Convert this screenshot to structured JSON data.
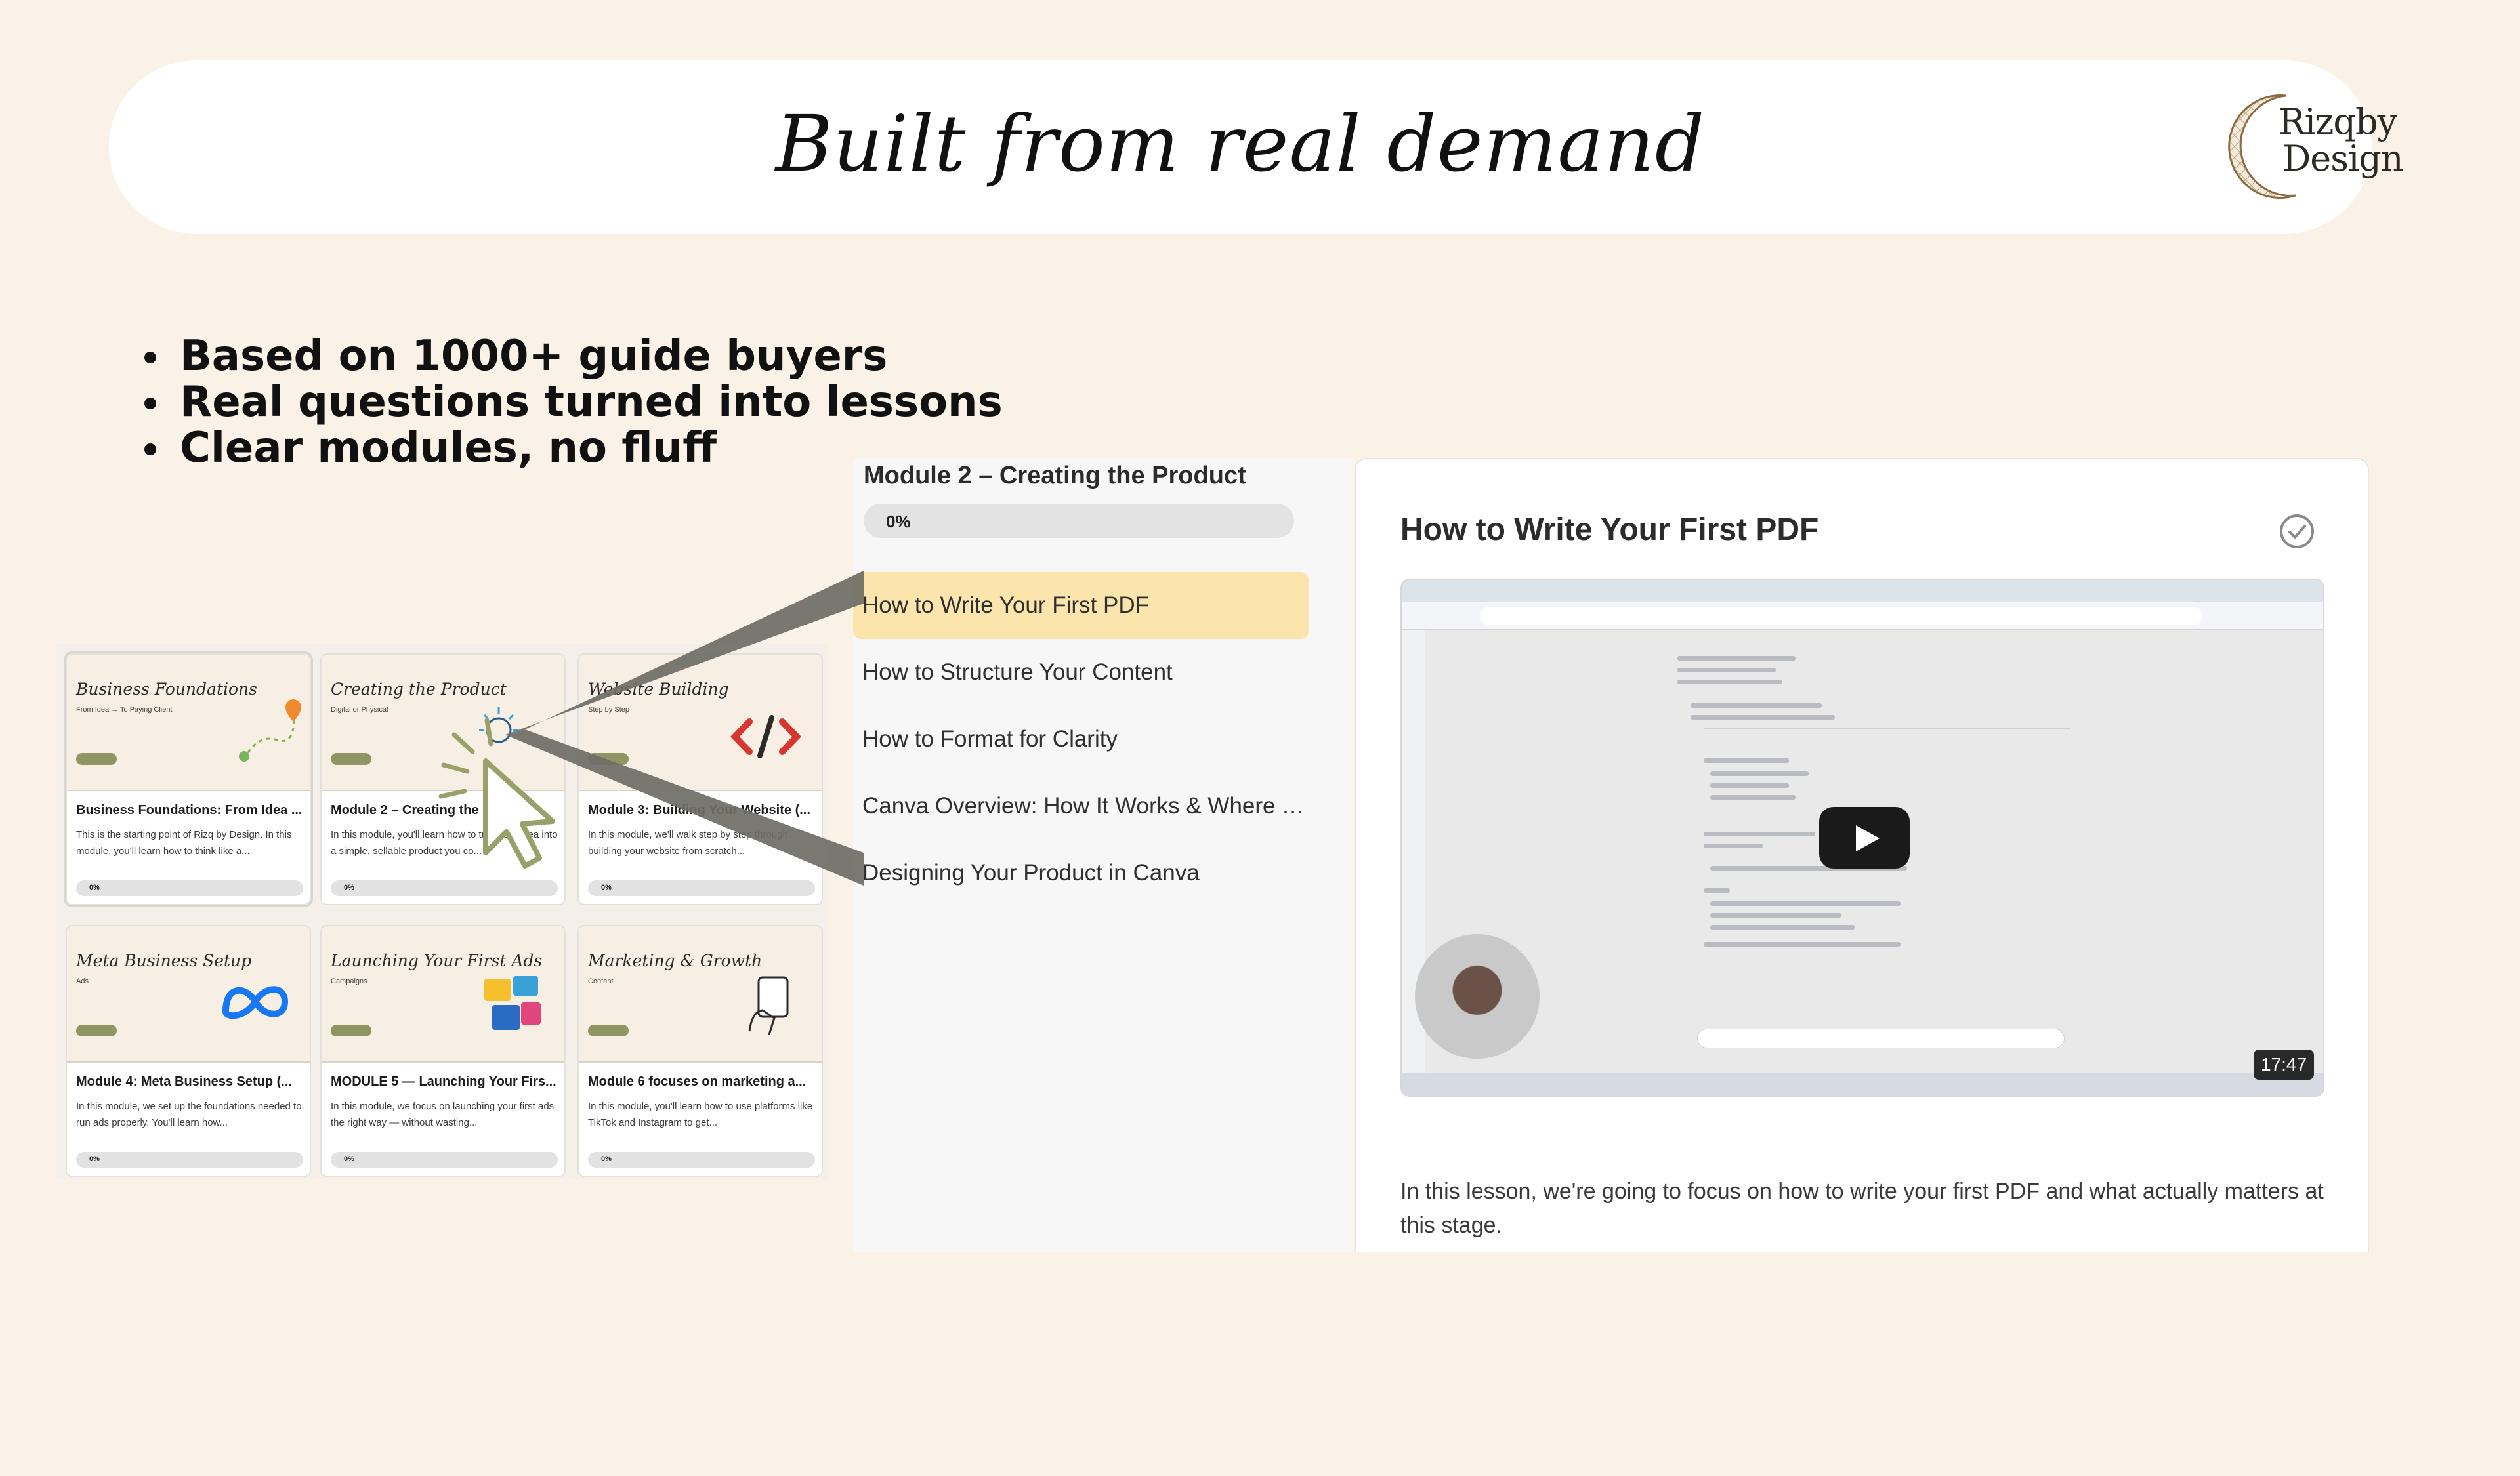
{
  "header": {
    "title": "Built from real demand",
    "logo_line1": "Rizqby",
    "logo_line2": "Design"
  },
  "bullets": [
    "Based on 1000+ guide buyers",
    "Real questions turned into lessons",
    "Clear modules, no fluff"
  ],
  "modules": [
    {
      "thumb_title": "Business Foundations",
      "thumb_sub": "From Idea → To Paying Client",
      "title": "Business Foundations: From Idea ...",
      "desc": "This is the starting point of Rizq by Design. In this module, you'll learn how to think like a...",
      "progress": "0%"
    },
    {
      "thumb_title": "Creating the Product",
      "thumb_sub": "Digital or Physical",
      "title": "Module 2 – Creating the Product",
      "desc": "In this module, you'll learn how to turn your idea into a simple, sellable product you co...",
      "progress": "0%"
    },
    {
      "thumb_title": "Website Building",
      "thumb_sub": "Step by Step",
      "title": "Module 3: Building Your Website (...",
      "desc": "In this module, we'll walk step by step through building your website from scratch...",
      "progress": "0%"
    },
    {
      "thumb_title": "Meta Business Setup",
      "thumb_sub": "Ads",
      "title": "Module 4: Meta Business Setup (...",
      "desc": "In this module, we set up the foundations needed to run ads properly. You'll learn how...",
      "progress": "0%"
    },
    {
      "thumb_title": "Launching Your First Ads",
      "thumb_sub": "Campaigns",
      "title": "MODULE 5 — Launching Your Firs...",
      "desc": "In this module, we focus on launching your first ads the right way — without wasting...",
      "progress": "0%"
    },
    {
      "thumb_title": "Marketing & Growth",
      "thumb_sub": "Content",
      "title": "Module 6 focuses on marketing a...",
      "desc": "In this module, you'll learn how to use platforms like TikTok and Instagram to get...",
      "progress": "0%"
    }
  ],
  "lesson_panel": {
    "module_title": "Module 2 – Creating the Product",
    "progress": "0%",
    "lessons": [
      "How to Write Your First PDF",
      "How to Structure Your Content",
      "How to Format for Clarity",
      "Canva Overview: How It Works & Where T...",
      "Designing Your Product in Canva"
    ],
    "active_index": 0
  },
  "content": {
    "heading": "How to Write Your First PDF",
    "video_duration": "17:47",
    "body": "In this lesson, we're going to focus on how to write your first PDF and what actually matters at this stage."
  },
  "colors": {
    "background": "#faf2e7",
    "active_lesson": "#fbe5ad",
    "pill": "#8f9664",
    "connector": "#6e6e66",
    "cursor": "#9aa06a"
  }
}
